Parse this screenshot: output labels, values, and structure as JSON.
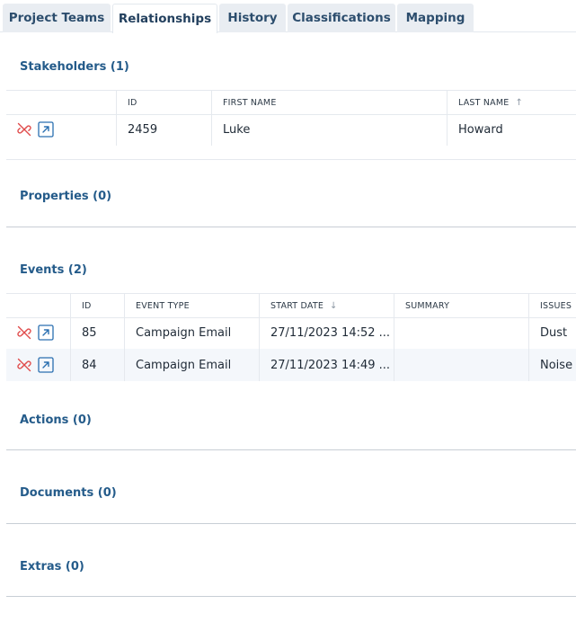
{
  "tabs": [
    {
      "label": "Project Teams"
    },
    {
      "label": "Relationships"
    },
    {
      "label": "History"
    },
    {
      "label": "Classifications"
    },
    {
      "label": "Mapping"
    }
  ],
  "active_tab": "Relationships",
  "stakeholders": {
    "title": "Stakeholders (1)",
    "columns": [
      "ID",
      "FIRST NAME",
      "LAST NAME"
    ],
    "sort_indicator": "↑",
    "rows": [
      {
        "id": "2459",
        "first_name": "Luke",
        "last_name": "Howard"
      }
    ]
  },
  "properties": {
    "title": "Properties (0)"
  },
  "events": {
    "title": "Events (2)",
    "columns": [
      "ID",
      "EVENT TYPE",
      "START DATE",
      "SUMMARY",
      "ISSUES"
    ],
    "sort_indicator": "↓",
    "rows": [
      {
        "id": "85",
        "event_type": "Campaign Email",
        "start_date": "27/11/2023 14:52 ...",
        "summary": "",
        "issues": "Dust"
      },
      {
        "id": "84",
        "event_type": "Campaign Email",
        "start_date": "27/11/2023 14:49 ...",
        "summary": "",
        "issues": "Noise"
      }
    ]
  },
  "actions": {
    "title": "Actions (0)"
  },
  "documents": {
    "title": "Documents (0)"
  },
  "extras": {
    "title": "Extras (0)"
  },
  "icons": {
    "unlink": "unlink-icon",
    "open": "open-external-icon"
  },
  "colors": {
    "accent": "#245b8a",
    "unlink": "#e04b4b",
    "open": "#2a6fb0",
    "tab_bg": "#e9edf2"
  }
}
